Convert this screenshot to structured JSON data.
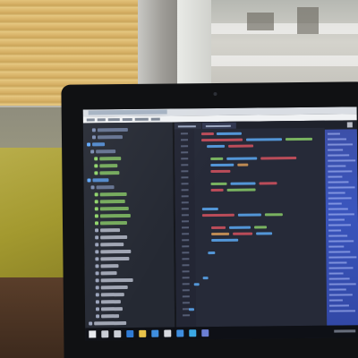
{
  "scene": {
    "description_tags": [
      "window-blinds",
      "yellow-chair",
      "laptop",
      "code-editor",
      "dark-theme",
      "windows-taskbar"
    ]
  },
  "laptop": {
    "screen": {
      "theme": "dark",
      "accent_colors": {
        "editor_bg": "#262a38",
        "explorer_bg": "#252933",
        "keyword_red": "#e05561",
        "string_green": "#8fd46a",
        "identifier_blue": "#5fb2ff",
        "number_orange": "#e3a35a",
        "panel_blue": "#3a55bd"
      },
      "explorer_icons": [
        "folder-icon",
        "file-icon"
      ],
      "taskbar_icons": [
        "windows-start-icon",
        "search-icon",
        "task-view-icon",
        "edge-icon",
        "folder-icon",
        "store-icon",
        "mail-icon",
        "photos-icon",
        "editor-icon",
        "media-icon"
      ]
    }
  }
}
